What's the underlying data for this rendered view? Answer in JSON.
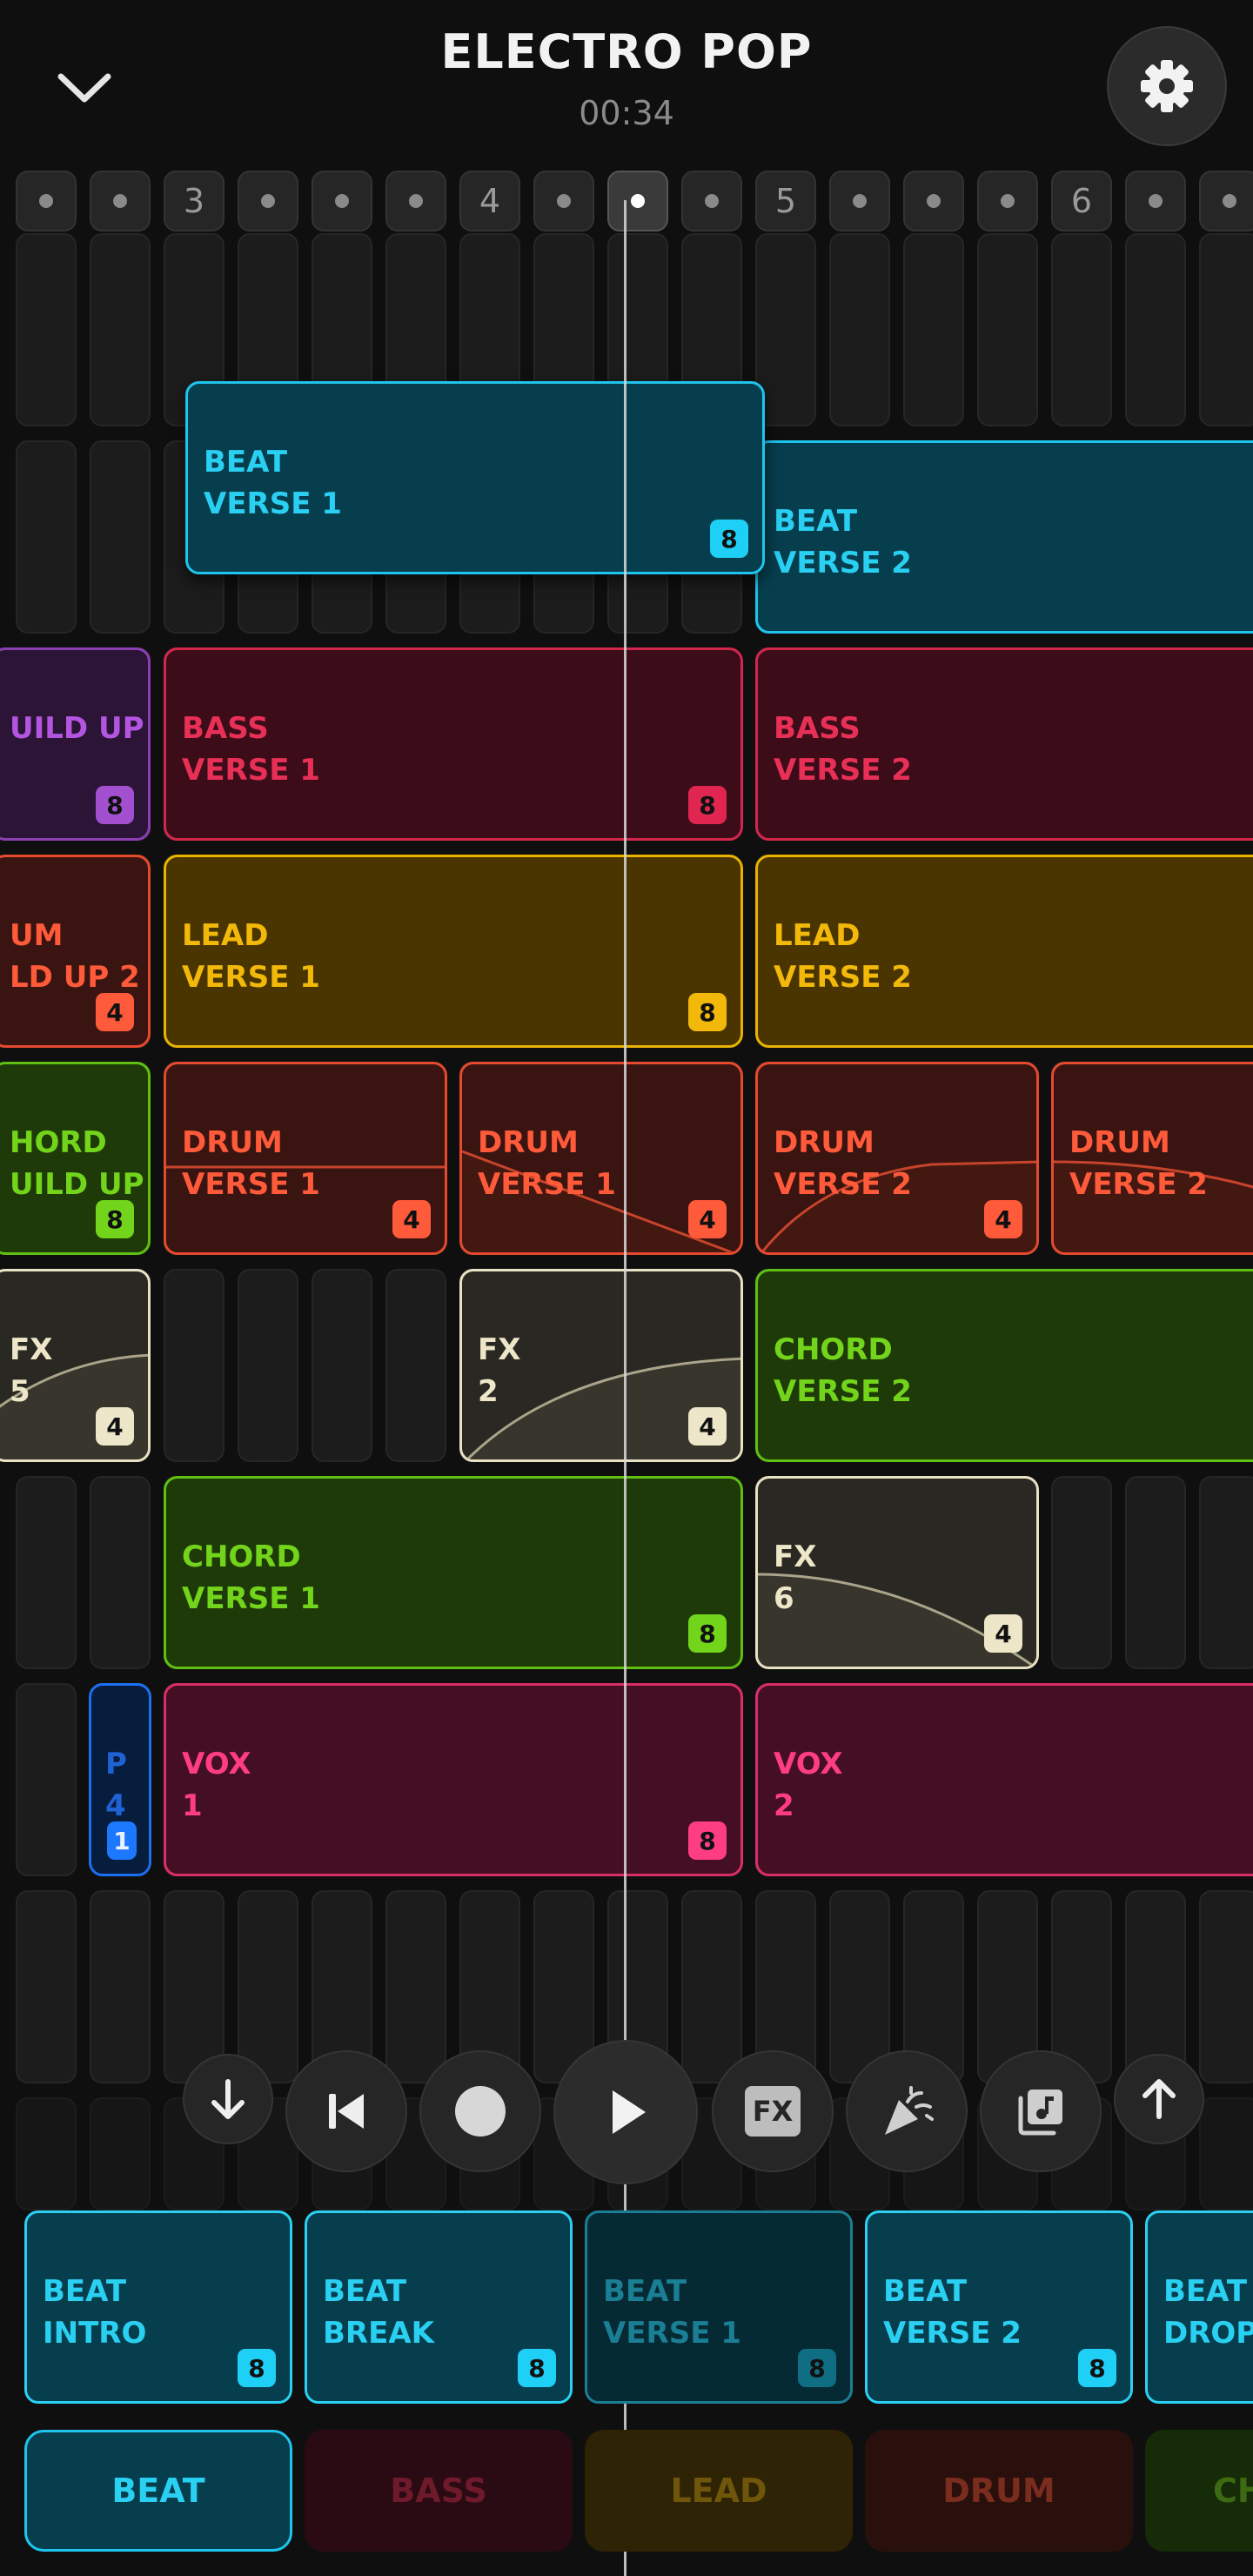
{
  "header": {
    "title": "ELECTRO POP",
    "time": "00:34"
  },
  "timeline": {
    "bar_labels": [
      "3",
      "4",
      "5",
      "6"
    ]
  },
  "clips": [
    {
      "id": "beat-verse-1",
      "label": "BEAT\nVERSE 1",
      "badge": "8",
      "type": "beat"
    },
    {
      "id": "beat-verse-2",
      "label": "BEAT\nVERSE 2",
      "badge": "",
      "type": "beat"
    },
    {
      "id": "build-up",
      "label": "UILD UP",
      "badge": "8",
      "type": "purple"
    },
    {
      "id": "bass-verse-1",
      "label": "BASS\nVERSE 1",
      "badge": "8",
      "type": "bass"
    },
    {
      "id": "bass-verse-2",
      "label": "BASS\nVERSE 2",
      "badge": "",
      "type": "bass"
    },
    {
      "id": "drum-build-up-2",
      "label": "UM\nLD UP 2",
      "badge": "4",
      "type": "drum"
    },
    {
      "id": "lead-verse-1",
      "label": "LEAD\nVERSE 1",
      "badge": "8",
      "type": "lead"
    },
    {
      "id": "lead-verse-2",
      "label": "LEAD\nVERSE 2",
      "badge": "",
      "type": "lead"
    },
    {
      "id": "chord-build-up",
      "label": "HORD\nUILD UP",
      "badge": "8",
      "type": "chord"
    },
    {
      "id": "drum-verse-1a",
      "label": "DRUM\nVERSE 1",
      "badge": "4",
      "type": "drum"
    },
    {
      "id": "drum-verse-1b",
      "label": "DRUM\nVERSE 1",
      "badge": "4",
      "type": "drum"
    },
    {
      "id": "drum-verse-2a",
      "label": "DRUM\nVERSE 2",
      "badge": "4",
      "type": "drum"
    },
    {
      "id": "drum-verse-2b",
      "label": "DRUM\nVERSE 2",
      "badge": "",
      "type": "drum"
    },
    {
      "id": "fx-5",
      "label": "FX\n5",
      "badge": "4",
      "type": "fx"
    },
    {
      "id": "fx-2",
      "label": "FX\n2",
      "badge": "4",
      "type": "fx"
    },
    {
      "id": "chord-verse-2",
      "label": "CHORD\nVERSE 2",
      "badge": "",
      "type": "chord"
    },
    {
      "id": "chord-verse-1",
      "label": "CHORD\nVERSE 1",
      "badge": "8",
      "type": "chord"
    },
    {
      "id": "fx-6",
      "label": "FX\n6",
      "badge": "4",
      "type": "fx"
    },
    {
      "id": "pad-4",
      "label": "P\n4",
      "badge": "1",
      "type": "pad"
    },
    {
      "id": "vox-1",
      "label": "VOX\n1",
      "badge": "8",
      "type": "vox"
    },
    {
      "id": "vox-2",
      "label": "VOX\n2",
      "badge": "",
      "type": "vox"
    }
  ],
  "transport": {
    "fx_label": "FX"
  },
  "palette": [
    {
      "label": "BEAT\nINTRO",
      "badge": "8"
    },
    {
      "label": "BEAT\nBREAK",
      "badge": "8"
    },
    {
      "label": "BEAT\nVERSE 1",
      "badge": "8",
      "dim": true
    },
    {
      "label": "BEAT\nVERSE 2",
      "badge": "8"
    },
    {
      "label": "BEAT\nDROP",
      "badge": ""
    }
  ],
  "tabs": [
    {
      "label": "BEAT",
      "active": true,
      "color": "#2ad0f2"
    },
    {
      "label": "BASS",
      "active": false,
      "color": "#e83057"
    },
    {
      "label": "LEAD",
      "active": false,
      "color": "#f2b90a"
    },
    {
      "label": "DRUM",
      "active": false,
      "color": "#ff5a3a"
    },
    {
      "label": "CH",
      "active": false,
      "color": "#72d41b"
    }
  ]
}
